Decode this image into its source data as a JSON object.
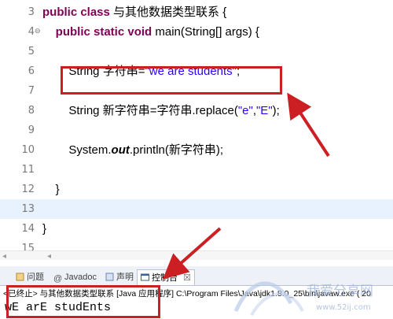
{
  "editor": {
    "lines": [
      {
        "num": "3",
        "parts": [
          {
            "t": "public class ",
            "c": "kw"
          },
          {
            "t": "与其他数据类型联系 {",
            "c": ""
          }
        ]
      },
      {
        "num": "4",
        "fold": "⊖",
        "parts": [
          {
            "t": "    public static void ",
            "c": "kw"
          },
          {
            "t": "main(String[] args) {",
            "c": ""
          }
        ]
      },
      {
        "num": "5",
        "parts": []
      },
      {
        "num": "6",
        "parts": [
          {
            "t": "        String 字符串=",
            "c": ""
          },
          {
            "t": "\"we are students\"",
            "c": "str"
          },
          {
            "t": ";",
            "c": ""
          }
        ]
      },
      {
        "num": "7",
        "parts": []
      },
      {
        "num": "8",
        "parts": [
          {
            "t": "        String 新字符串=字符串.replace(",
            "c": ""
          },
          {
            "t": "\"e\"",
            "c": "str"
          },
          {
            "t": ",",
            "c": ""
          },
          {
            "t": "\"E\"",
            "c": "str"
          },
          {
            "t": ");",
            "c": ""
          }
        ]
      },
      {
        "num": "9",
        "parts": []
      },
      {
        "num": "10",
        "parts": [
          {
            "t": "        System.",
            "c": ""
          },
          {
            "t": "out",
            "c": "italic-bold"
          },
          {
            "t": ".println(新字符串);",
            "c": ""
          }
        ]
      },
      {
        "num": "11",
        "parts": []
      },
      {
        "num": "12",
        "parts": [
          {
            "t": "    }",
            "c": ""
          }
        ]
      },
      {
        "num": "13",
        "parts": [],
        "current": true
      },
      {
        "num": "14",
        "parts": [
          {
            "t": "}",
            "c": ""
          }
        ]
      },
      {
        "num": "15",
        "parts": []
      }
    ]
  },
  "panel": {
    "tabs": [
      {
        "label": "问题",
        "icon": "problems-icon"
      },
      {
        "label": "Javadoc",
        "icon": "javadoc-icon"
      },
      {
        "label": "声明",
        "icon": "declaration-icon"
      },
      {
        "label": "控制台",
        "icon": "console-icon",
        "active": true,
        "close": "☒"
      }
    ],
    "console_title": "<已终止> 与其他数据类型联系 [Java 应用程序] C:\\Program Files\\Java\\jdk1.8.0_25\\bin\\javaw.exe ( 20",
    "console_output": "wE arE studEnts"
  },
  "watermark": {
    "text": "我爱分享网",
    "url": "www.52ij.com"
  },
  "colors": {
    "keyword": "#7f0055",
    "string": "#2a00ff",
    "highlight_box": "#cc1f24",
    "current_line": "#e8f2fe"
  }
}
